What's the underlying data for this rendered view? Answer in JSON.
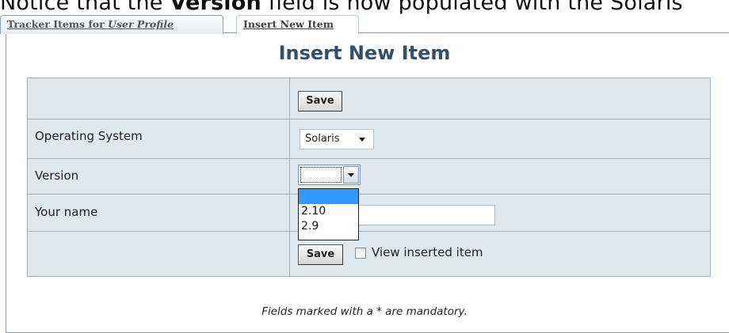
{
  "caption": {
    "prefix": "Notice that the ",
    "field": "Version",
    "suffix": " field is now populated with the Solaris"
  },
  "tabs": [
    {
      "label_prefix": "Tracker Items for ",
      "label_emphasis": "User Profile",
      "active": false
    },
    {
      "label": "Insert New Item",
      "active": true
    }
  ],
  "form": {
    "title": "Insert New Item",
    "save_label": "Save",
    "fields": {
      "operating_system": {
        "label": "Operating System",
        "value": "Solaris"
      },
      "version": {
        "label": "Version",
        "value": "",
        "options": [
          "",
          "2.10",
          "2.9"
        ],
        "open": true
      },
      "your_name": {
        "label": "Your name",
        "value": ""
      }
    },
    "view_inserted": {
      "label": "View inserted item",
      "checked": false
    }
  },
  "footnote": "Fields marked with a * are mandatory.",
  "colors": {
    "heading": "#33506a",
    "table_bg": "#e0e8ef",
    "table_border": "#9fb1c2",
    "dropdown_highlight": "#3399ff"
  }
}
